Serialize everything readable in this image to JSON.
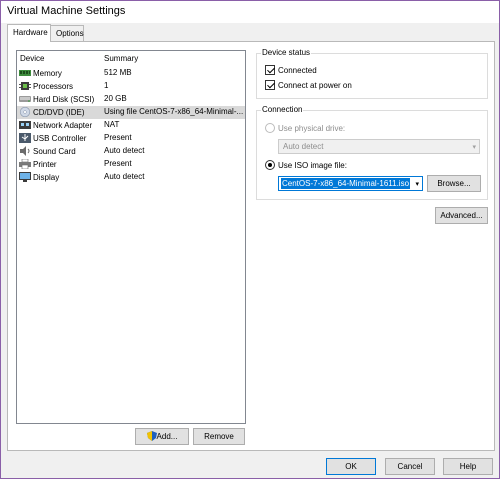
{
  "window": {
    "title": "Virtual Machine Settings"
  },
  "tabs": [
    {
      "label": "Hardware",
      "active": true
    },
    {
      "label": "Options",
      "active": false
    }
  ],
  "device_list": {
    "headers": {
      "device": "Device",
      "summary": "Summary"
    },
    "rows": [
      {
        "icon": "memory-icon",
        "device": "Memory",
        "summary": "512 MB"
      },
      {
        "icon": "processor-icon",
        "device": "Processors",
        "summary": "1"
      },
      {
        "icon": "hard-disk-icon",
        "device": "Hard Disk (SCSI)",
        "summary": "20 GB"
      },
      {
        "icon": "cd-dvd-icon",
        "device": "CD/DVD (IDE)",
        "summary": "Using file CentOS-7-x86_64-Minimal-...",
        "selected": true
      },
      {
        "icon": "network-adapter-icon",
        "device": "Network Adapter",
        "summary": "NAT"
      },
      {
        "icon": "usb-icon",
        "device": "USB Controller",
        "summary": "Present"
      },
      {
        "icon": "sound-card-icon",
        "device": "Sound Card",
        "summary": "Auto detect"
      },
      {
        "icon": "printer-icon",
        "device": "Printer",
        "summary": "Present"
      },
      {
        "icon": "display-icon",
        "device": "Display",
        "summary": "Auto detect"
      }
    ]
  },
  "list_buttons": {
    "add": "Add...",
    "remove": "Remove"
  },
  "device_status": {
    "label": "Device status",
    "connected": {
      "label": "Connected",
      "checked": true
    },
    "connect_power_on": {
      "label": "Connect at power on",
      "checked": true
    }
  },
  "connection": {
    "label": "Connection",
    "physical_drive": {
      "label": "Use physical drive:",
      "selected": false,
      "value": "Auto detect"
    },
    "iso_image": {
      "label": "Use ISO image file:",
      "selected": true,
      "value": "CentOS-7-x86_64-Minimal-1611.iso"
    },
    "browse": "Browse..."
  },
  "advanced_button": "Advanced...",
  "footer": {
    "ok": "OK",
    "cancel": "Cancel",
    "help": "Help"
  },
  "colors": {
    "accent": "#0078d7",
    "selected_row": "#d9d9d9",
    "window_border": "#8a5fa8"
  }
}
